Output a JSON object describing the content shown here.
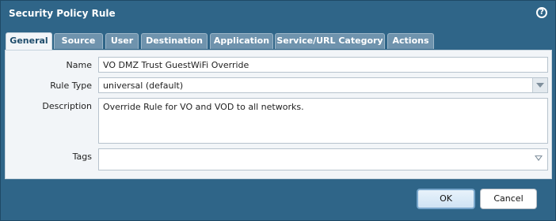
{
  "dialog": {
    "title": "Security Policy Rule",
    "help_icon_text": "?"
  },
  "tabs": [
    {
      "label": "General"
    },
    {
      "label": "Source"
    },
    {
      "label": "User"
    },
    {
      "label": "Destination"
    },
    {
      "label": "Application"
    },
    {
      "label": "Service/URL Category"
    },
    {
      "label": "Actions"
    }
  ],
  "active_tab": "General",
  "form": {
    "name_label": "Name",
    "name_value": "VO DMZ Trust GuestWiFi Override",
    "rule_type_label": "Rule Type",
    "rule_type_value": "universal (default)",
    "description_label": "Description",
    "description_value": "Override Rule for VO and VOD to all networks.",
    "tags_label": "Tags",
    "tags_value": ""
  },
  "buttons": {
    "ok": "OK",
    "cancel": "Cancel"
  },
  "icons": {
    "help": "help-icon",
    "dropdown": "chevron-down-icon",
    "tags_dropdown": "funnel-down-icon"
  }
}
